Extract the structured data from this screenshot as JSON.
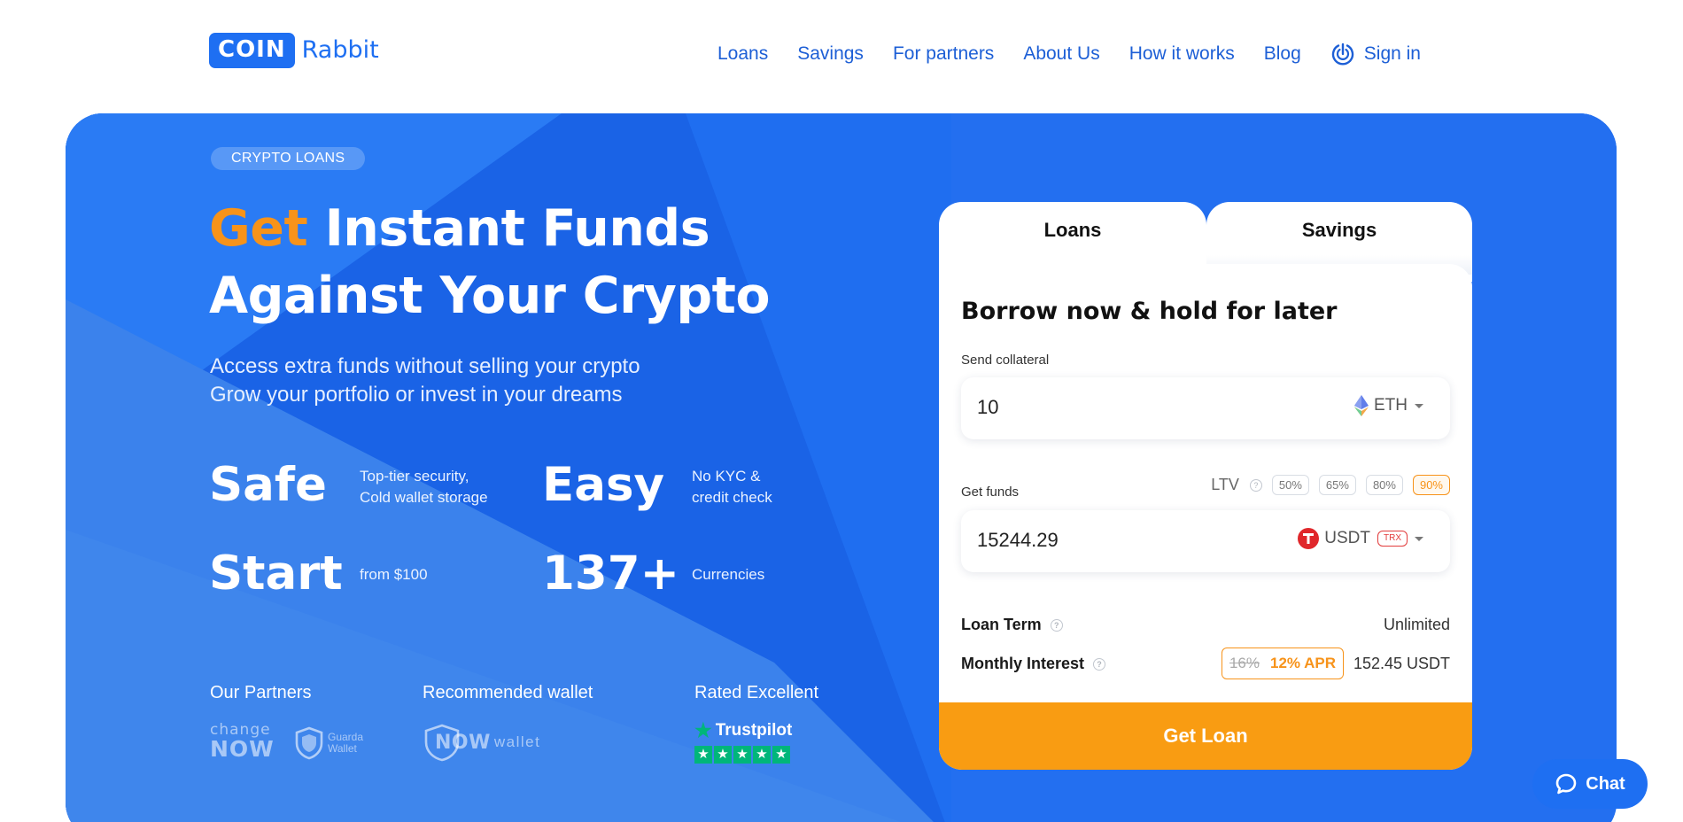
{
  "header": {
    "logo_box": "COIN",
    "logo_text": "Rabbit",
    "nav": [
      "Loans",
      "Savings",
      "For partners",
      "About Us",
      "How it works",
      "Blog"
    ],
    "signin": "Sign in"
  },
  "hero": {
    "badge": "CRYPTO LOANS",
    "headline_accent": "Get",
    "headline_rest": "Instant Funds",
    "headline_line2": "Against Your Crypto",
    "sub_line1": "Access extra funds without selling your crypto",
    "sub_line2": "Grow your portfolio or invest in your dreams",
    "features": [
      {
        "big": "Safe",
        "small_line1": "Top-tier security,",
        "small_line2": "Cold wallet storage"
      },
      {
        "big": "Easy",
        "small_line1": "No KYC &",
        "small_line2": "credit check"
      },
      {
        "big": "Start",
        "small_line1": "from $100",
        "small_line2": ""
      },
      {
        "big": "137+",
        "small_line1": "Currencies",
        "small_line2": ""
      }
    ],
    "partners_title": "Our Partners",
    "wallet_title": "Recommended wallet",
    "rated_title": "Rated Excellent",
    "changenow_top": "change",
    "changenow_bottom": "NOW",
    "guarda_line1": "Guarda",
    "guarda_line2": "Wallet",
    "nowwallet_now": "NOW",
    "nowwallet_wallet": "wallet",
    "trustpilot": "Trustpilot",
    "trustpilot_stars": 5
  },
  "card": {
    "tabs": [
      "Loans",
      "Savings"
    ],
    "title": "Borrow now & hold for later",
    "send_label": "Send collateral",
    "send_value": "10",
    "send_currency": "ETH",
    "get_label": "Get funds",
    "ltv_label": "LTV",
    "ltv_options": [
      "50%",
      "65%",
      "80%",
      "90%"
    ],
    "ltv_selected": "90%",
    "get_value": "15244.29",
    "get_currency": "USDT",
    "get_network": "TRX",
    "term_label": "Loan Term",
    "term_value": "Unlimited",
    "interest_label": "Monthly Interest",
    "apr_old": "16%",
    "apr_new": "12% APR",
    "interest_value": "152.45 USDT",
    "cta": "Get Loan"
  },
  "chat": {
    "label": "Chat"
  },
  "colors": {
    "brand_blue": "#1e6ff2",
    "accent_orange": "#f7931a",
    "cta_orange": "#f99c12",
    "trustpilot_green": "#00b67a"
  },
  "icons": [
    "signin-icon",
    "eth-icon",
    "tether-icon",
    "help-icon",
    "star-icon",
    "chat-bubble-icon",
    "shield-icon"
  ]
}
